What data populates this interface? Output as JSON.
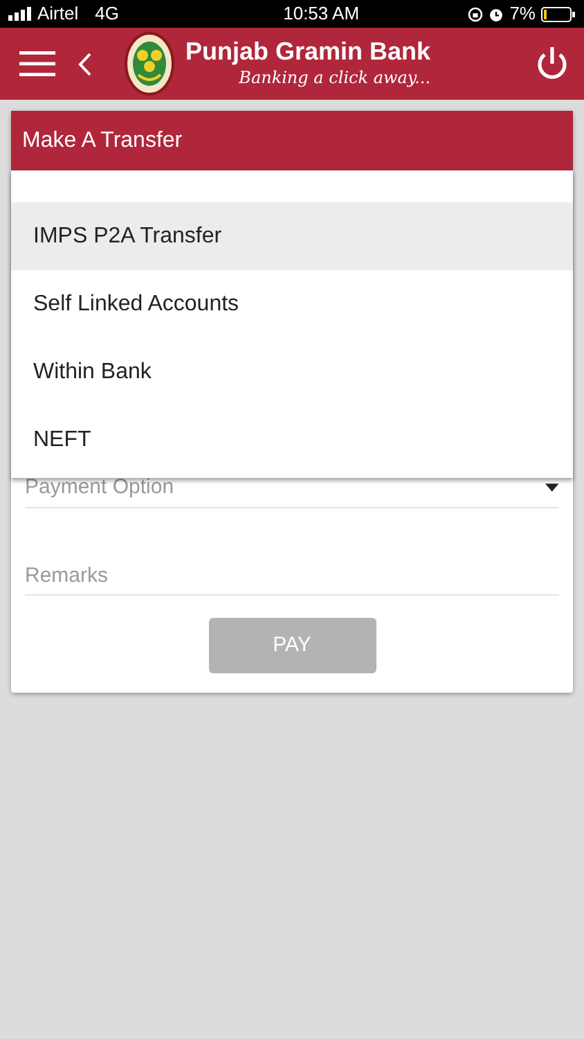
{
  "status_bar": {
    "carrier": "Airtel",
    "network": "4G",
    "time": "10:53 AM",
    "battery": "7%"
  },
  "header": {
    "title": "Punjab Gramin Bank",
    "tagline": "Banking a click away..."
  },
  "card": {
    "title": "Make A Transfer",
    "menu": {
      "items": [
        {
          "label": "IMPS P2A Transfer",
          "selected": true
        },
        {
          "label": "Self Linked Accounts",
          "selected": false
        },
        {
          "label": "Within Bank",
          "selected": false
        },
        {
          "label": "NEFT",
          "selected": false
        }
      ]
    },
    "fields": [
      {
        "kind": "select",
        "placeholder": "Payment Option"
      },
      {
        "kind": "text",
        "placeholder": "Remarks"
      }
    ],
    "button": {
      "label": "PAY",
      "disabled": true
    }
  }
}
